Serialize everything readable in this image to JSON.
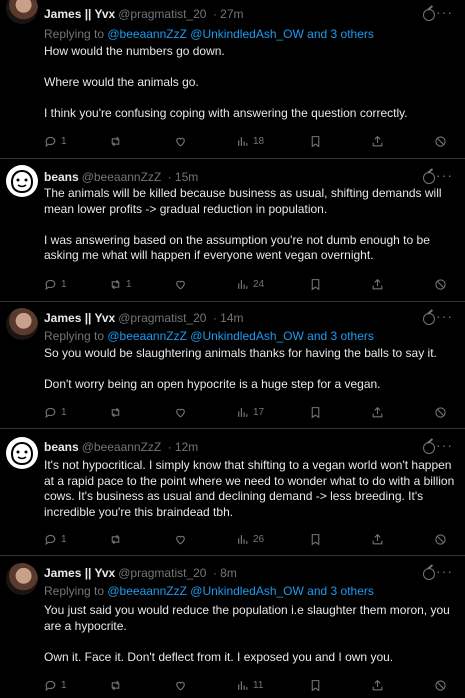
{
  "tweets": [
    {
      "name": "James || Yvx",
      "handle": "@pragmatist_20",
      "time": "· 27m",
      "avatar": "james-avatar",
      "reply_prefix": "Replying to ",
      "reply_mentions": "@beeaannZzZ @UnkindledAsh_OW and 3 others",
      "paragraphs": [
        "How would the numbers go down.",
        "Where would the animals go.",
        "I think you're confusing coping with answering the question correctly."
      ],
      "replies": "1",
      "reposts": "",
      "likes": "",
      "views": "18"
    },
    {
      "name": "beans",
      "handle": "@beeaannZzZ",
      "time": "· 15m",
      "avatar": "beans-avatar",
      "paragraphs": [
        "The animals will be killed because business as usual, shifting demands will mean lower profits -> gradual reduction in population.",
        "I was answering based on the assumption you're not dumb enough to be asking me what will happen if everyone went vegan overnight."
      ],
      "replies": "1",
      "reposts": "1",
      "likes": "",
      "views": "24"
    },
    {
      "name": "James || Yvx",
      "handle": "@pragmatist_20",
      "time": "· 14m",
      "avatar": "james-avatar",
      "reply_prefix": "Replying to ",
      "reply_mentions": "@beeaannZzZ @UnkindledAsh_OW and 3 others",
      "paragraphs": [
        "So you would be slaughtering animals thanks for having the balls to say it.",
        "Don't worry being an open hypocrite is a huge step for a vegan."
      ],
      "replies": "1",
      "reposts": "",
      "likes": "",
      "views": "17"
    },
    {
      "name": "beans",
      "handle": "@beeaannZzZ",
      "time": "· 12m",
      "avatar": "beans-avatar",
      "paragraphs": [
        "It's not hypocritical. I simply know that shifting to a vegan world won't happen at a rapid pace to the point where we need to wonder what to do with a billion cows. It's business as usual and declining demand -> less breeding. It's incredible you're this braindead tbh."
      ],
      "replies": "1",
      "reposts": "",
      "likes": "",
      "views": "26"
    },
    {
      "name": "James || Yvx",
      "handle": "@pragmatist_20",
      "time": "· 8m",
      "avatar": "james-avatar",
      "reply_prefix": "Replying to ",
      "reply_mentions": "@beeaannZzZ @UnkindledAsh_OW and 3 others",
      "paragraphs": [
        "You just said you would reduce the population i.e slaughter them moron, you are a hypocrite.",
        "Own it. Face it. Don't deflect from it. I exposed you and I own you."
      ],
      "replies": "1",
      "reposts": "",
      "likes": "",
      "views": "11"
    }
  ],
  "more_label": "···",
  "colors": {
    "background": "#000000",
    "text": "#e7e9ea",
    "muted": "#71767b",
    "link": "#1d9bf0",
    "divider": "#2f3336"
  }
}
